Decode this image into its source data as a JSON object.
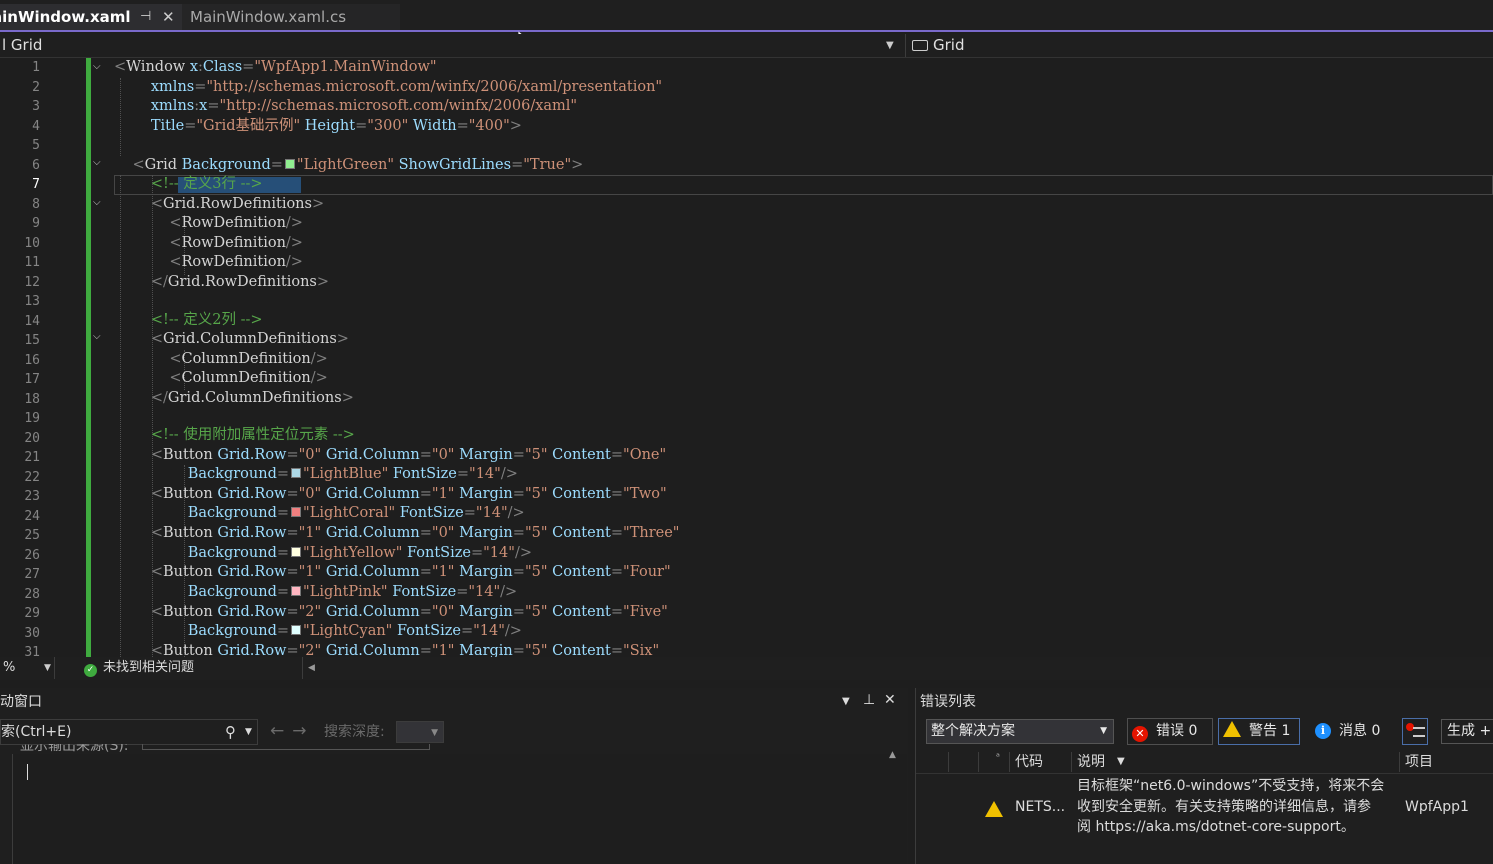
{
  "tabs": {
    "active": {
      "label": "ainWindow.xaml",
      "pin": "⊣",
      "close": "✕"
    },
    "inactive": {
      "label": "MainWindow.xaml.cs"
    }
  },
  "navbar": {
    "left": "l Grid",
    "right": "Grid"
  },
  "editor": {
    "line_numbers": [
      "1",
      "2",
      "3",
      "4",
      "5",
      "6",
      "7",
      "8",
      "9",
      "10",
      "11",
      "12",
      "13",
      "14",
      "15",
      "16",
      "17",
      "18",
      "19",
      "20",
      "21",
      "22",
      "23",
      "24",
      "25",
      "26",
      "27",
      "28",
      "29",
      "30",
      "31"
    ],
    "current_line": "7",
    "colors": {
      "LightGreen": "#90ee90",
      "LightBlue": "#add8e6",
      "LightCoral": "#f08080",
      "LightYellow": "#ffffe0",
      "LightPink": "#ffb6c1",
      "LightCyan": "#e0ffff"
    }
  },
  "status": {
    "zoom": "%",
    "issues": "未找到相关问题"
  },
  "output": {
    "title": "动窗口",
    "search_placeholder": "索(Ctrl+E)",
    "depth_label": "搜索深度:",
    "source_label": "显示输出来源(S):"
  },
  "errors": {
    "title": "错误列表",
    "scope": "整个解决方案",
    "errors_label": "错误 0",
    "warnings_label": "警告 1",
    "messages_label": "消息 0",
    "build_label": "生成 +",
    "columns": {
      "code": "代码",
      "description": "说明",
      "project": "项目"
    },
    "rows": [
      {
        "code": "NETS...",
        "description": "目标框架“net6.0-windows”不受支持，将来不会\n收到安全更新。有关支持策略的详细信息，请参\n阅 https://aka.ms/dotnet-core-support。",
        "project": "WpfApp1"
      }
    ]
  }
}
